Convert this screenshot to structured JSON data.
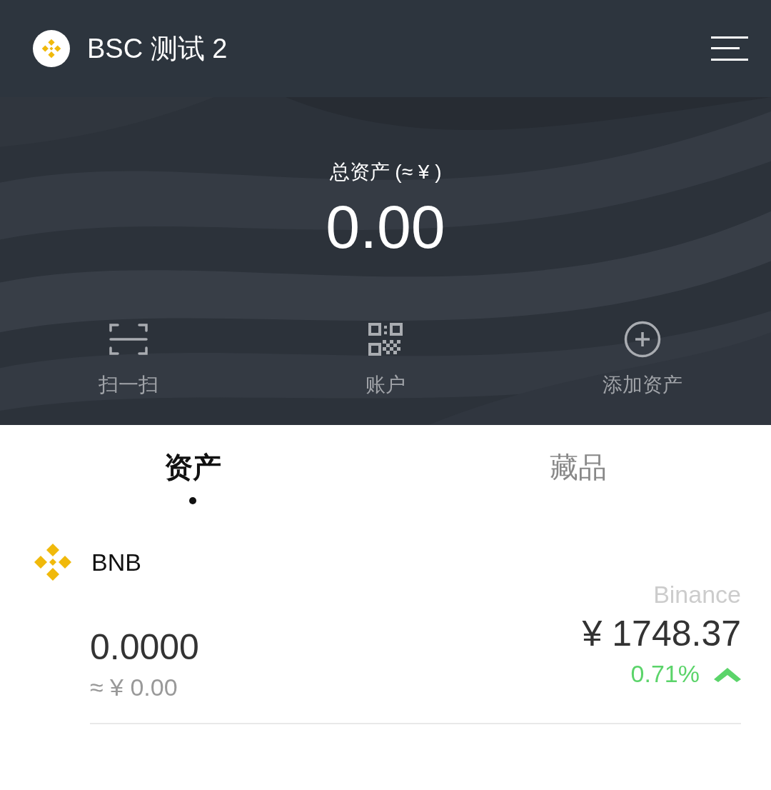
{
  "header": {
    "wallet_name": "BSC 测试 2"
  },
  "summary": {
    "label": "总资产 (≈ ¥ )",
    "total": "0.00"
  },
  "actions": [
    {
      "kind": "scan",
      "label": "扫一扫"
    },
    {
      "kind": "qr",
      "label": "账户"
    },
    {
      "kind": "add",
      "label": "添加资产"
    }
  ],
  "tabs": [
    {
      "label": "资产",
      "selected": true
    },
    {
      "label": "藏品",
      "selected": false
    }
  ],
  "assets": [
    {
      "symbol": "BNB",
      "balance": "0.0000",
      "balance_value": "≈ ¥ 0.00",
      "source": "Binance",
      "price": "¥ 1748.37",
      "change": "0.71%",
      "rising": true
    }
  ]
}
